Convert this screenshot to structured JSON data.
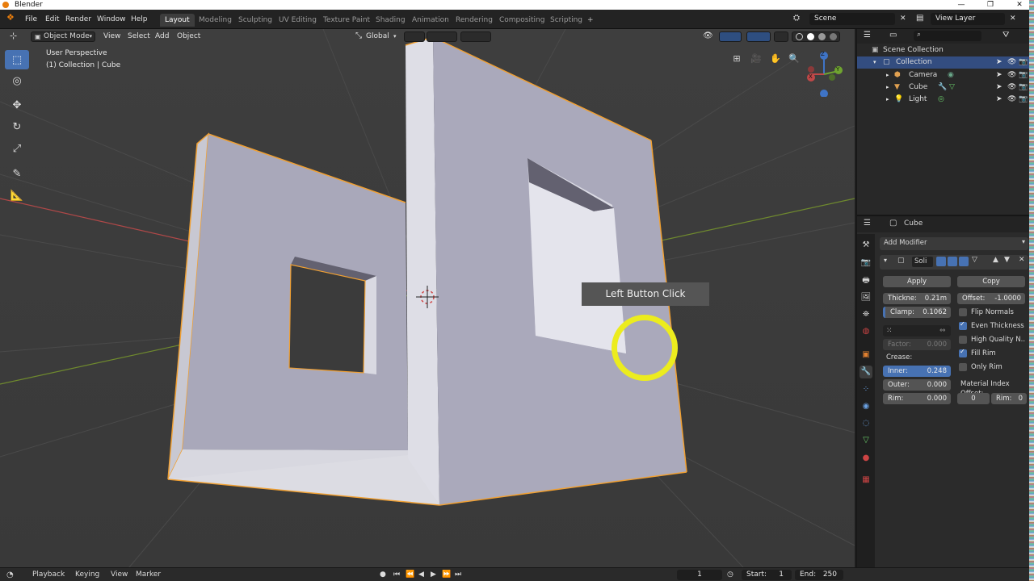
{
  "titlebar": {
    "title": "Blender",
    "min": "—",
    "max": "❐",
    "close": "✕"
  },
  "menu": [
    "File",
    "Edit",
    "Render",
    "Window",
    "Help"
  ],
  "workspaces": [
    "Layout",
    "Modeling",
    "Sculpting",
    "UV Editing",
    "Texture Paint",
    "Shading",
    "Animation",
    "Rendering",
    "Compositing",
    "Scripting"
  ],
  "workspace_add": "+",
  "scene": "Scene",
  "view_layer": "View Layer",
  "viewport": {
    "mode": "Object Mode",
    "menus": [
      "View",
      "Select",
      "Add",
      "Object"
    ],
    "orientation": "Global",
    "info_line1": "User Perspective",
    "info_line2": "(1) Collection | Cube",
    "axis_x": "X",
    "axis_y": "Y",
    "axis_z": "Z"
  },
  "tooltip": "Left Button Click",
  "outliner": {
    "root": "Scene Collection",
    "collection": "Collection",
    "items": [
      "Camera",
      "Cube",
      "Light"
    ]
  },
  "properties": {
    "object_name": "Cube",
    "add_modifier": "Add Modifier",
    "modifier_name": "Soli",
    "apply": "Apply",
    "copy": "Copy",
    "thickness_label": "Thickne:",
    "thickness_value": "0.21m",
    "offset_label": "Offset:",
    "offset_value": "-1.0000",
    "clamp_label": "Clamp:",
    "clamp_value": "0.1062",
    "flip_normals": "Flip Normals",
    "even_thickness": "Even Thickness",
    "high_quality": "High Quality N..",
    "fill_rim": "Fill Rim",
    "only_rim": "Only Rim",
    "factor_label": "Factor:",
    "factor_value": "0.000",
    "crease": "Crease:",
    "inner_label": "Inner:",
    "inner_value": "0.248",
    "outer_label": "Outer:",
    "outer_value": "0.000",
    "rim_label": "Rim:",
    "rim_value": "0.000",
    "material_index_offset": "Material Index Offset:",
    "mat_value": "0",
    "mat_rim_label": "Rim:",
    "mat_rim_value": "0",
    "checks": {
      "flip_normals": false,
      "even_thickness": true,
      "high_quality": false,
      "fill_rim": true,
      "only_rim": false
    }
  },
  "timeline": {
    "menus": [
      "Playback",
      "Keying",
      "View",
      "Marker"
    ],
    "current_frame": "1",
    "start_label": "Start:",
    "start": "1",
    "end_label": "End:",
    "end": "250"
  },
  "colors": {
    "accent": "#4772b3",
    "selection_outline": "#f0a033",
    "click_ring": "#ecec1e",
    "mesh_light": "#d8d8e0",
    "mesh_mid": "#aaa9bb"
  }
}
